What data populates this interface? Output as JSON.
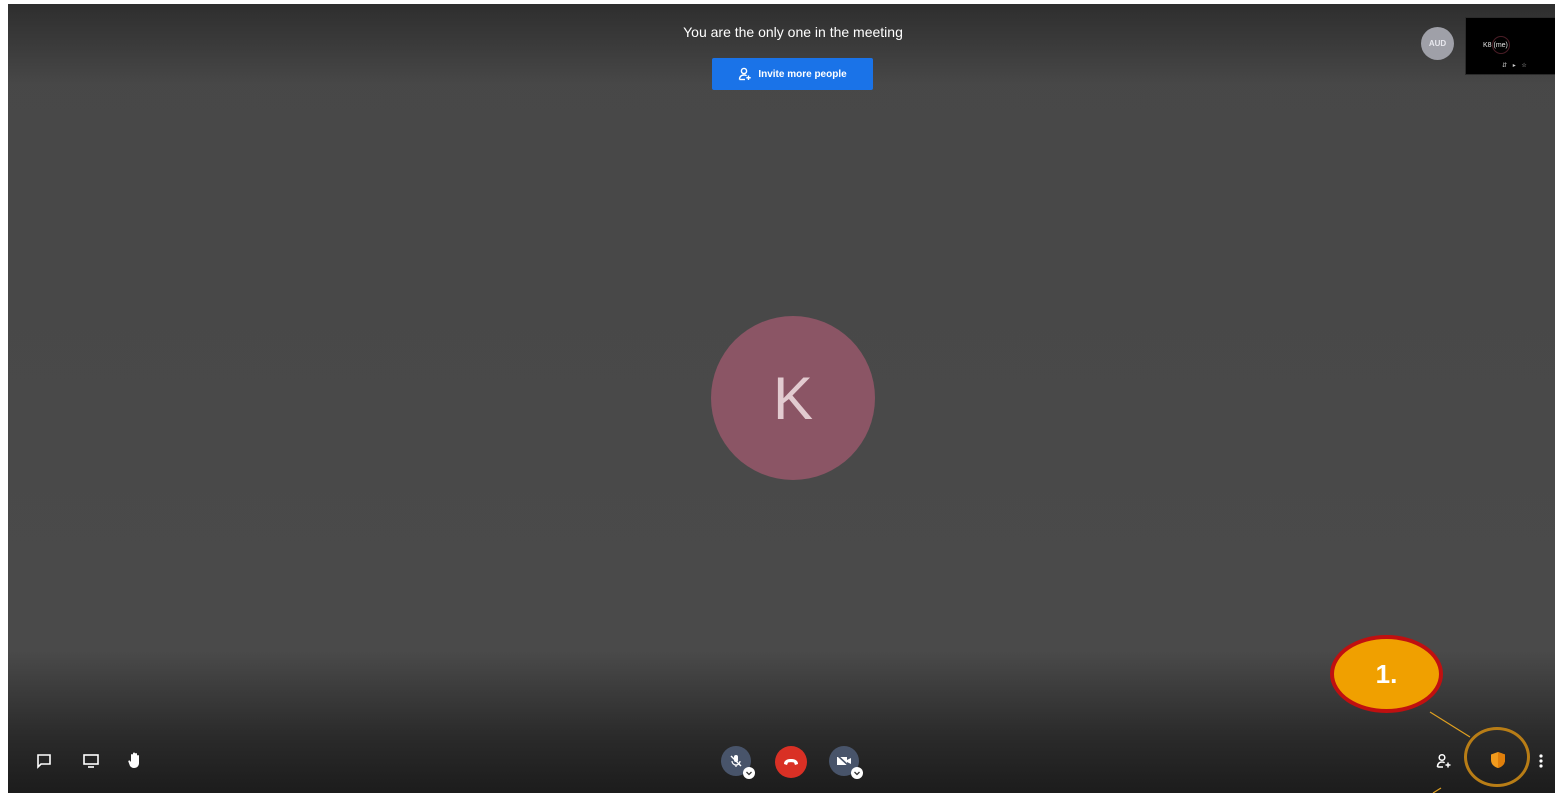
{
  "header": {
    "notice": "You are the only one in the meeting",
    "invite_label": "Invite more people"
  },
  "participants": {
    "small_avatar_initials": "AUD",
    "thumbnail_name": "K8 (me)",
    "thumbnail_icons": "⇵ ▸ ☆",
    "main_avatar_initial": "K"
  },
  "toolbar": {
    "left": [
      "chat-icon",
      "screen-share-icon",
      "raise-hand-icon"
    ],
    "center": [
      "microphone-muted-icon",
      "hang-up-icon",
      "camera-off-icon"
    ],
    "right": [
      "participants-icon",
      "security-shield-icon",
      "more-options-icon"
    ]
  },
  "annotation": {
    "label": "1."
  },
  "colors": {
    "stage": "#4a4a4a",
    "invite_button": "#1a73e8",
    "avatar": "#8b5565",
    "hangup": "#d93025",
    "shield": "#f29b1d",
    "annotation_fill": "#f0a000",
    "annotation_border": "#c01010"
  }
}
